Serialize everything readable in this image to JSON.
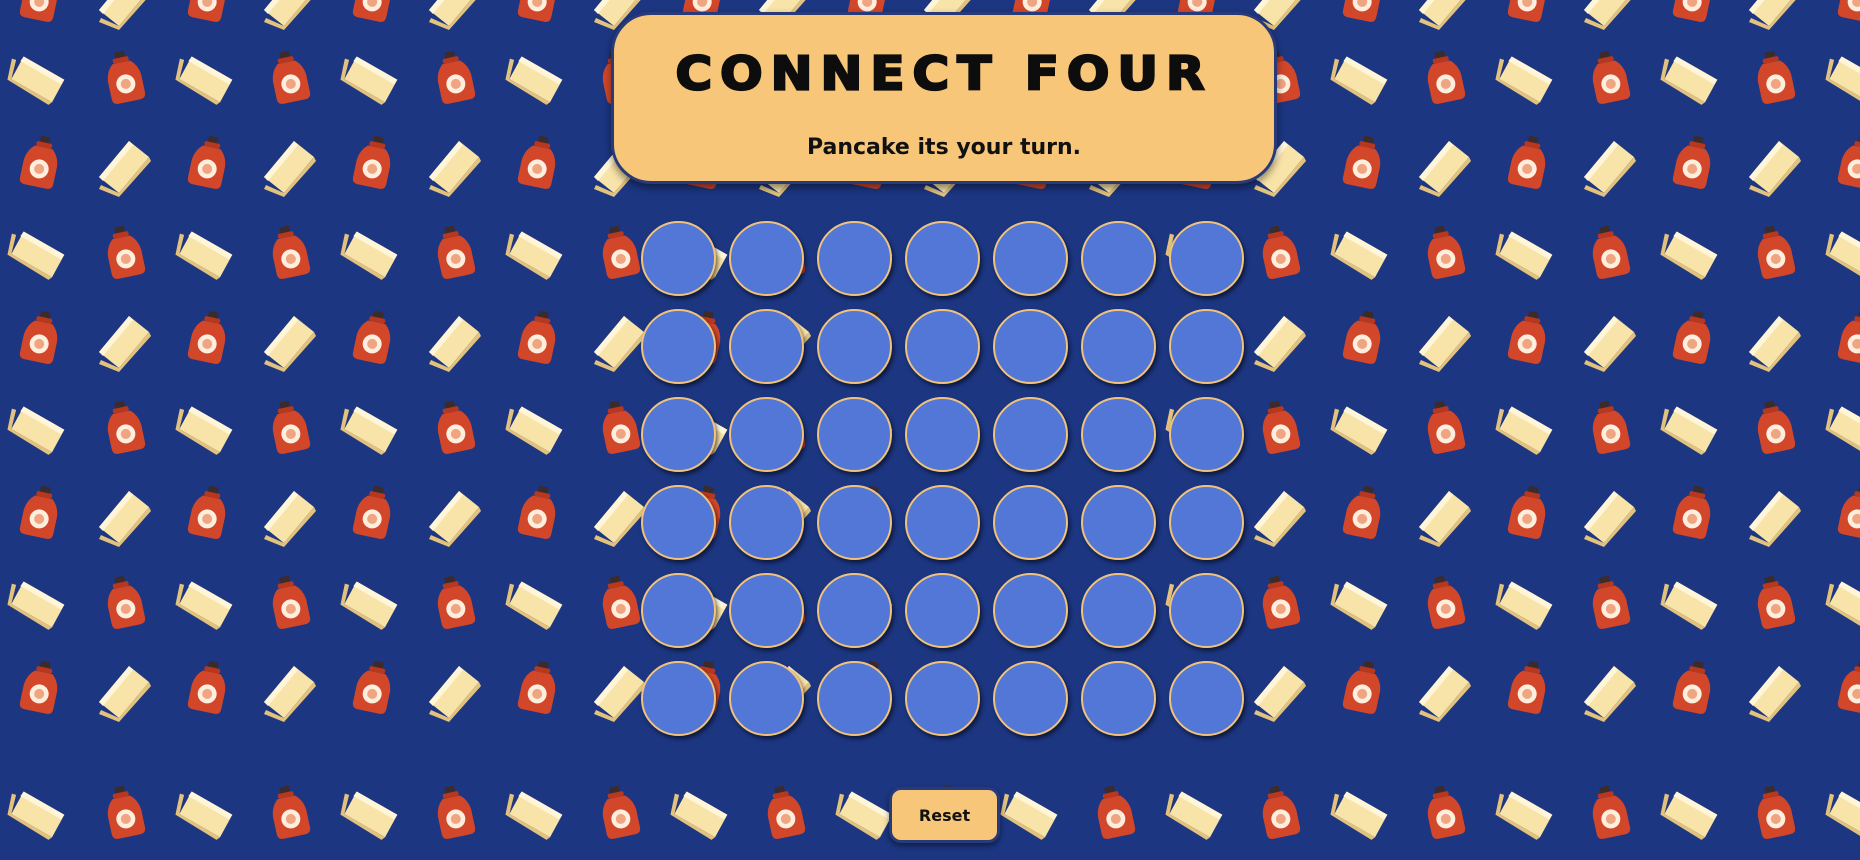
{
  "game": {
    "title": "Connect Four",
    "turn_message": "Pancake its your turn.",
    "reset_label": "Reset",
    "rows": 6,
    "columns": 7,
    "board": [
      [
        "",
        "",
        "",
        "",
        "",
        "",
        ""
      ],
      [
        "",
        "",
        "",
        "",
        "",
        "",
        ""
      ],
      [
        "",
        "",
        "",
        "",
        "",
        "",
        ""
      ],
      [
        "",
        "",
        "",
        "",
        "",
        "",
        ""
      ],
      [
        "",
        "",
        "",
        "",
        "",
        "",
        ""
      ],
      [
        "",
        "",
        "",
        "",
        "",
        "",
        ""
      ]
    ]
  },
  "background": {
    "pattern_icons": [
      "syrup-bottle-icon",
      "butter-icon"
    ]
  },
  "colors": {
    "background": "#1c3682",
    "card": "#f8c678",
    "card_border": "#283a78",
    "empty_cell": "#5277d7",
    "cell_border": "#f0c27e",
    "syrup": "#d2462a",
    "butter": "#f6dfa2"
  }
}
